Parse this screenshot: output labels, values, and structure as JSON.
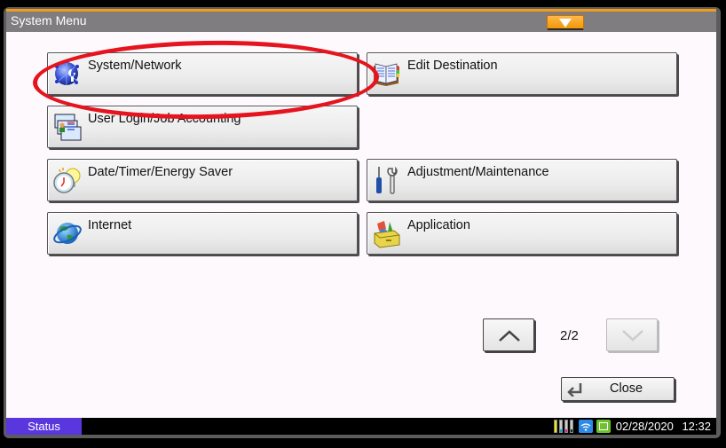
{
  "window": {
    "title": "System Menu",
    "title_dropdown_icon": "triangle-down-icon",
    "accent_color": "#f39c1a"
  },
  "menu": {
    "items": [
      {
        "label": "System/Network",
        "icon": "globe-wrench-icon",
        "highlighted": true
      },
      {
        "label": "Edit Destination",
        "icon": "address-book-icon"
      },
      {
        "label": "User Login/Job Accounting",
        "icon": "id-cards-icon"
      },
      {
        "label": "Date/Timer/Energy Saver",
        "icon": "clock-bulb-icon"
      },
      {
        "label": "Adjustment/Maintenance",
        "icon": "screwdriver-wrench-icon"
      },
      {
        "label": "Internet",
        "icon": "globe-icon"
      },
      {
        "label": "Application",
        "icon": "app-box-icon"
      }
    ]
  },
  "pagination": {
    "indicator": "2/2",
    "up_icon": "chevron-up-icon",
    "down_icon": "chevron-down-icon",
    "down_disabled": true
  },
  "close_button": {
    "label": "Close",
    "icon": "return-arrow-icon"
  },
  "status_bar": {
    "status_label": "Status",
    "status_color": "#5a36df",
    "date": "02/28/2020",
    "time": "12:32",
    "toner": [
      "yellow",
      "cyan",
      "magenta",
      "black"
    ],
    "icons": [
      "toner-levels-icon",
      "wifi-icon",
      "energy-saver-icon"
    ]
  }
}
